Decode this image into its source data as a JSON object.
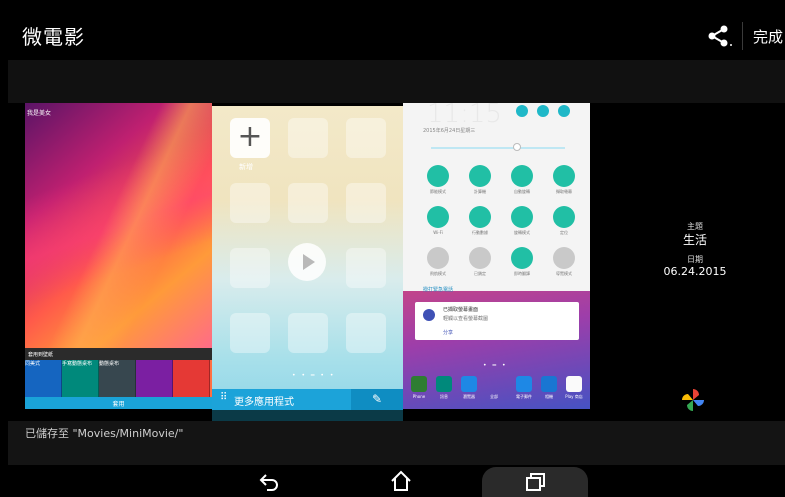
{
  "header": {
    "title": "微電影",
    "share_icon": "share-icon",
    "done_label": "完成"
  },
  "previews": {
    "panel1": {
      "top_text": "我是美女",
      "toolbar_text": "套用到壁紙",
      "tiles": [
        "同美式",
        "手寫動態桌布",
        "動態桌布"
      ],
      "apply_label": "套用"
    },
    "panel2": {
      "add_label": "新增",
      "more_apps_label": "更多應用程式"
    },
    "panel3": {
      "time": "11:15",
      "date": "2015年6月24日星期三",
      "quick_settings": [
        "節能模式",
        "計算機",
        "自動旋轉",
        "擷取螢幕",
        "Wi-Fi",
        "行動數據",
        "旋轉模式",
        "定位",
        "飛航模式",
        "已鎖定",
        "即時翻譯",
        "導覽模式"
      ],
      "emergency": "撥打緊急電話",
      "notification_title": "已擷取螢幕畫面",
      "notification_body": "輕觸以查看螢幕截圖",
      "notification_action": "分享",
      "dock": [
        "Phone",
        "訊息",
        "瀏覽器",
        "全部",
        "電子郵件",
        "相機",
        "Play 商店"
      ]
    }
  },
  "info": {
    "theme_label": "主題",
    "theme_value": "生活",
    "date_label": "日期",
    "date_value": "06.24.2015"
  },
  "status": {
    "saved_text": "已儲存至 \"Movies/MiniMovie/\""
  },
  "navbar": {
    "back_icon": "back-icon",
    "home_icon": "home-icon",
    "recent_icon": "recent-apps-icon"
  }
}
